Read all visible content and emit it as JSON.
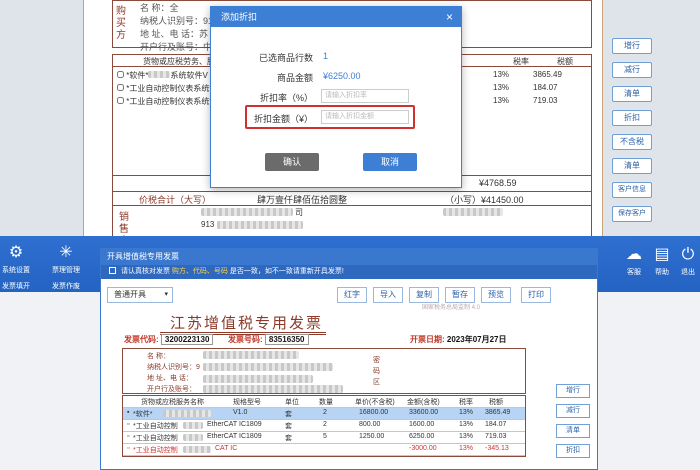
{
  "top": {
    "buyer_heading": "购买方",
    "buyer_lines": [
      "名    称：全",
      "纳税人识别号：91",
      "地 址、电 话：苏",
      "开户行及账号：中"
    ],
    "table_header": [
      "货物或应税劳务、服务名称",
      "税率",
      "税额"
    ],
    "rows": [
      {
        "name": "*软件*",
        "suffix": "系统软件V",
        "rate": "13%",
        "tax": "3865.49"
      },
      {
        "name": "*工业自动控制仪表系统*E",
        "suffix": "",
        "rate": "13%",
        "tax": "184.07"
      },
      {
        "name": "*工业自动控制仪表系统*E",
        "suffix": "",
        "rate": "13%",
        "tax": "719.03"
      }
    ],
    "sum_tax": "¥4768.59",
    "total_heading": "价税合计（大写）",
    "total_upper": "肆万壹仟肆佰伍拾圆整",
    "total_small": "（小写）¥41450.00",
    "seller_heading": "销售方",
    "seller_code": "913",
    "seller_suffix": "司",
    "side_buttons": [
      "增行",
      "减行",
      "清单",
      "折扣",
      "不含税",
      "清单",
      "客户信息",
      "保存客户"
    ]
  },
  "dialog": {
    "title": "添加折扣",
    "close": "×",
    "selected_rows_label": "已选商品行数",
    "selected_rows_value": "1",
    "amount_label": "商品金额",
    "amount_value": "¥6250.00",
    "rate_label": "折扣率（%）",
    "rate_placeholder": "请输入折扣率",
    "discount_label": "折扣金额（¥）",
    "discount_placeholder": "请输入折扣金额",
    "ok": "确认",
    "cancel": "取消"
  },
  "app": {
    "left_icons": [
      {
        "glyph": "⚙",
        "label": "系统设置",
        "icon": "settings-icon"
      },
      {
        "glyph": "✳",
        "label": "票理管理",
        "icon": "network-icon"
      }
    ],
    "left_sub": [
      "发票填开",
      "发票作废"
    ],
    "right_icons": [
      {
        "glyph": "☁",
        "label": "客服",
        "icon": "service-icon"
      },
      {
        "glyph": "▤",
        "label": "帮助",
        "icon": "help-icon"
      },
      {
        "glyph": "⏻",
        "label": "退出",
        "icon": "power-icon"
      }
    ],
    "window_title": "开具增值税专用发票",
    "notice_pre": "请认真核对发票",
    "notice_red": "购方、代码、号码",
    "notice_post": "是否一致，如不一致请重新开具发票!",
    "mode_select": "普通开具",
    "toolbar": [
      "红字",
      "导入",
      "复制",
      "暂存",
      "预览",
      "打印"
    ],
    "invoice_title": "江苏增值税专用发票",
    "invoice_sub": "国家税务总局监制 4.0",
    "code_label": "发票代码:",
    "code_value": "3200223130",
    "number_label": "发票号码:",
    "number_value": "83516350",
    "date_label": "开票日期:",
    "date_value": "2023年07月27日",
    "buyer_lines": [
      "名    称：",
      "纳税人识别号：9",
      "地 址、电 话：",
      "开户行及账号："
    ],
    "password_area": "密码区",
    "columns": [
      "货物或应税服务名称",
      "规格型号",
      "单位",
      "数量",
      "单价(不含税)",
      "金额(含税)",
      "税率",
      "税额"
    ],
    "items": [
      {
        "name": "*软件*",
        "spec": "V1.0",
        "unit": "套",
        "qty": "2",
        "price": "16800.00",
        "amount": "33600.00",
        "rate": "13%",
        "tax": "3865.49",
        "selected": true
      },
      {
        "name": "*工业自动控制",
        "spec": "EtherCAT IC1809",
        "unit": "套",
        "qty": "2",
        "price": "800.00",
        "amount": "1600.00",
        "rate": "13%",
        "tax": "184.07",
        "selected": false
      },
      {
        "name": "*工业自动控制",
        "spec": "EtherCAT IC1809",
        "unit": "套",
        "qty": "5",
        "price": "1250.00",
        "amount": "6250.00",
        "rate": "13%",
        "tax": "719.03",
        "selected": false
      },
      {
        "name": "*工业自动控制",
        "spec": "CAT IC",
        "unit": "",
        "qty": "",
        "price": "",
        "amount": "-3000.00",
        "rate": "13%",
        "tax": "-345.13",
        "selected": false
      }
    ],
    "side_buttons": [
      "增行",
      "减行",
      "清单",
      "折扣"
    ]
  }
}
